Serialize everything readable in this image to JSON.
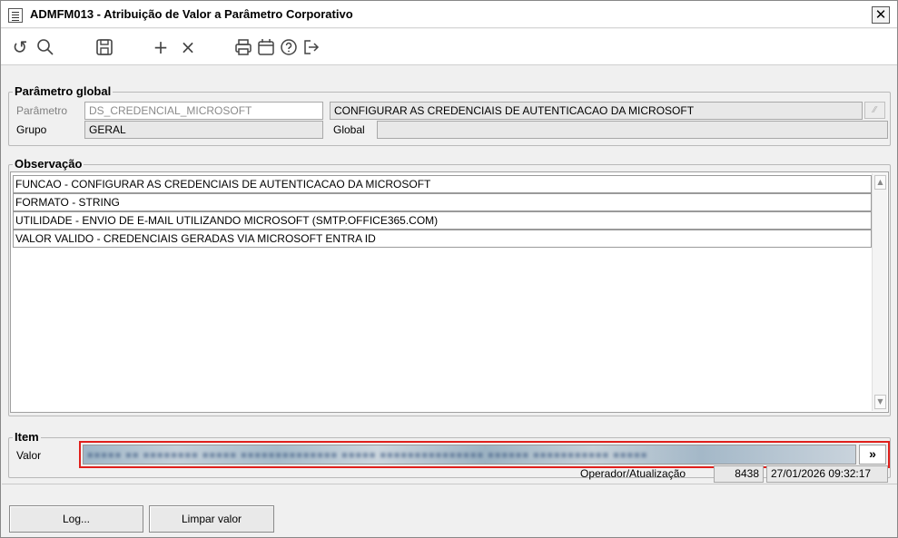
{
  "window": {
    "title": "ADMFM013 - Atribuição de Valor a Parâmetro Corporativo",
    "close_label": "✕"
  },
  "toolbar": {
    "icons": [
      "refresh-icon",
      "search-icon",
      "save-icon",
      "add-icon",
      "delete-icon",
      "print-icon",
      "calendar-icon",
      "help-icon",
      "exit-icon"
    ]
  },
  "parametro_global": {
    "legend": "Parâmetro global",
    "parametro_label": "Parâmetro",
    "parametro_value": "DS_CREDENCIAL_MICROSOFT",
    "descricao_value": "CONFIGURAR AS CREDENCIAIS DE AUTENTICACAO DA MICROSOFT",
    "grupo_label": "Grupo",
    "grupo_value": "GERAL",
    "global_label": "Global",
    "global_value": ""
  },
  "observacao": {
    "legend": "Observação",
    "lines": [
      "FUNCAO - CONFIGURAR AS CREDENCIAIS DE AUTENTICACAO DA MICROSOFT",
      "FORMATO - STRING",
      "UTILIDADE - ENVIO DE E-MAIL UTILIZANDO MICROSOFT (SMTP.OFFICE365.COM)",
      "VALOR VALIDO - CREDENCIAIS GERADAS VIA MICROSOFT ENTRA ID"
    ]
  },
  "item": {
    "legend": "Item",
    "valor_label": "Valor",
    "expand_label": "»",
    "operador_label": "Operador/Atualização",
    "operador_value": "8438",
    "atualizacao_value": "27/01/2026 09:32:17"
  },
  "buttons": {
    "log": "Log...",
    "limpar": "Limpar valor"
  }
}
